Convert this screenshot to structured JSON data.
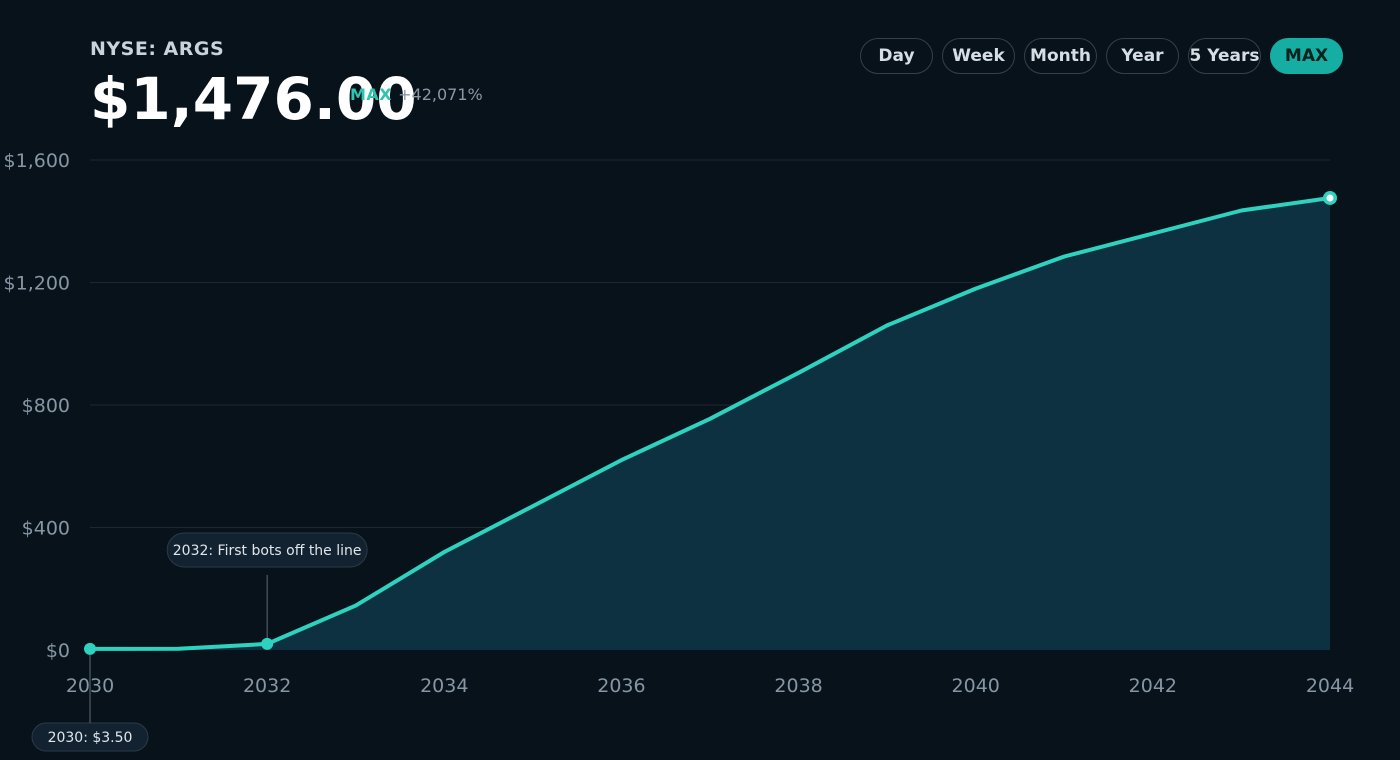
{
  "header": {
    "ticker": "NYSE: ARGS",
    "price": "$1,476.00",
    "range_tag": "MAX",
    "change_pct": "+42,071%"
  },
  "range_buttons": [
    {
      "label": "Day",
      "active": false
    },
    {
      "label": "Week",
      "active": false
    },
    {
      "label": "Month",
      "active": false
    },
    {
      "label": "Year",
      "active": false
    },
    {
      "label": "5 Years",
      "active": false
    },
    {
      "label": "MAX",
      "active": true
    }
  ],
  "colors": {
    "background": "#07121b",
    "line": "#2ed3bf",
    "area": "#0e3142",
    "grid": "#1c2833",
    "accent": "#16aea2"
  },
  "chart_data": {
    "type": "area",
    "x": [
      2030,
      2031,
      2032,
      2033,
      2034,
      2035,
      2036,
      2037,
      2038,
      2039,
      2040,
      2041,
      2042,
      2043,
      2044
    ],
    "series": [
      {
        "values": [
          3.5,
          4,
          20,
          145,
          320,
          470,
          620,
          755,
          905,
          1060,
          1180,
          1285,
          1360,
          1435,
          1476
        ]
      }
    ],
    "xlim": [
      2030,
      2044
    ],
    "ylim": [
      0,
      1600
    ],
    "x_ticks": [
      2030,
      2032,
      2034,
      2036,
      2038,
      2040,
      2042,
      2044
    ],
    "x_tick_labels": [
      "2030",
      "2032",
      "2034",
      "2036",
      "2038",
      "2040",
      "2042",
      "2044"
    ],
    "y_ticks": [
      0,
      400,
      800,
      1200,
      1600
    ],
    "y_tick_labels": [
      "$0",
      "$400",
      "$800",
      "$1,200",
      "$1,600"
    ],
    "grid": true,
    "annotations": [
      {
        "x": 2032,
        "y": 20,
        "text": "2032: First bots off the line",
        "placement": "above"
      },
      {
        "x": 2030,
        "y": 3.5,
        "text": "2030: $3.50",
        "placement": "below"
      }
    ],
    "end_marker": {
      "x": 2044,
      "y": 1476
    }
  }
}
